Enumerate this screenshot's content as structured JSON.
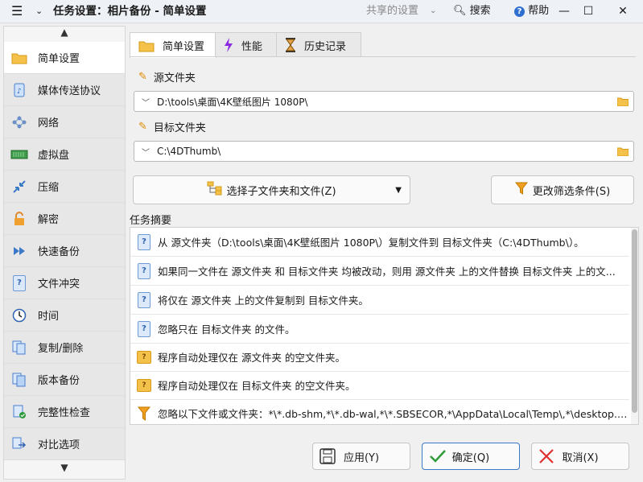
{
  "window": {
    "title": "任务设置：相片备份 - 简单设置",
    "shared_settings": "共享的设置",
    "search": "搜索",
    "help": "帮助"
  },
  "sidebar": {
    "items": [
      {
        "label": "简单设置",
        "icon": "folder-icon",
        "active": true
      },
      {
        "label": "媒体传送协议",
        "icon": "media-device-icon"
      },
      {
        "label": "网络",
        "icon": "network-icon"
      },
      {
        "label": "虚拟盘",
        "icon": "virtual-drive-icon"
      },
      {
        "label": "压缩",
        "icon": "compress-icon"
      },
      {
        "label": "解密",
        "icon": "unlock-icon"
      },
      {
        "label": "快速备份",
        "icon": "fast-forward-icon"
      },
      {
        "label": "文件冲突",
        "icon": "file-conflict-icon"
      },
      {
        "label": "时间",
        "icon": "clock-icon"
      },
      {
        "label": "复制/删除",
        "icon": "copy-delete-icon"
      },
      {
        "label": "版本备份",
        "icon": "versioning-icon"
      },
      {
        "label": "完整性检查",
        "icon": "integrity-check-icon"
      },
      {
        "label": "对比选项",
        "icon": "compare-icon"
      }
    ]
  },
  "tabs": [
    {
      "label": "简单设置",
      "icon": "folder-icon",
      "active": true
    },
    {
      "label": "性能",
      "icon": "lightning-icon"
    },
    {
      "label": "历史记录",
      "icon": "hourglass-icon"
    }
  ],
  "source": {
    "label": "源文件夹",
    "path": "D:\\tools\\桌面\\4K壁纸图片 1080P\\"
  },
  "target": {
    "label": "目标文件夹",
    "path": "C:\\4DThumb\\"
  },
  "buttons": {
    "select_subfolders": "选择子文件夹和文件(Z)",
    "change_filter": "更改筛选条件(S)",
    "apply": "应用(Y)",
    "ok": "确定(Q)",
    "cancel": "取消(X)"
  },
  "summary": {
    "title": "任务摘要",
    "rows": [
      {
        "icon": "doc-question-icon",
        "text": "从 源文件夹（D:\\tools\\桌面\\4K壁纸图片 1080P\\）复制文件到 目标文件夹（C:\\4DThumb\\）。"
      },
      {
        "icon": "doc-question-icon",
        "text": "如果同一文件在 源文件夹 和 目标文件夹 均被改动，则用 源文件夹 上的文件替换 目标文件夹 上的文..."
      },
      {
        "icon": "doc-question-icon",
        "text": "将仅在 源文件夹 上的文件复制到 目标文件夹。"
      },
      {
        "icon": "doc-question-icon",
        "text": "忽略只在 目标文件夹 的文件。"
      },
      {
        "icon": "folder-question-icon",
        "text": "程序自动处理仅在 源文件夹 的空文件夹。"
      },
      {
        "icon": "folder-question-icon",
        "text": "程序自动处理仅在 目标文件夹 的空文件夹。"
      },
      {
        "icon": "filter-icon",
        "text": "忽略以下文件或文件夹：*\\*.db-shm,*\\*.db-wal,*\\*.SBSECOR,*\\AppData\\Local\\Temp\\,*\\desktop.ini,*\\DfsrP..."
      }
    ]
  },
  "colors": {
    "accent": "#3a78c8",
    "folder": "#f4c24a",
    "filter": "#f0a020",
    "ok_check": "#2e9b3a",
    "cancel_x": "#e03030"
  }
}
